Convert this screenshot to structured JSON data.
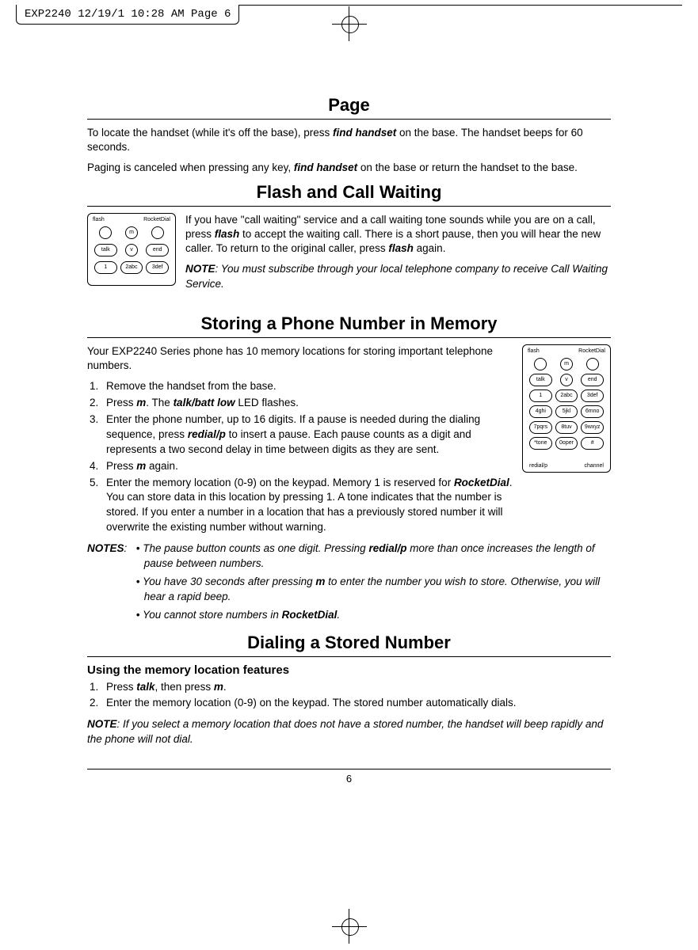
{
  "crop_header": "EXP2240  12/19/1 10:28 AM  Page 6",
  "page_number": "6",
  "section_page": {
    "title": "Page",
    "p1_a": "To locate the handset (while it's off the base), press ",
    "p1_b": "find handset",
    "p1_c": " on the base. The handset beeps for 60 seconds.",
    "p2_a": "Paging is canceled when pressing any key, ",
    "p2_b": "find handset",
    "p2_c": " on the base or return the handset to the base."
  },
  "section_flash": {
    "title": "Flash and Call Waiting",
    "p1_a": "If you have \"call waiting\" service and a call waiting tone sounds while you are on a call, press ",
    "p1_b": "flash",
    "p1_c": " to accept the waiting call. There is a short pause, then you will hear the new caller. To return to the original caller, press ",
    "p1_d": "flash",
    "p1_e": " again.",
    "note_label": "NOTE",
    "note_text": ": You must subscribe through your local telephone company to receive Call Waiting Service.",
    "thumb": {
      "tl": "flash",
      "tr": "RocketDial"
    }
  },
  "section_storing": {
    "title": "Storing a Phone Number in Memory",
    "intro": "Your EXP2240 Series phone has 10 memory locations for storing important telephone numbers.",
    "steps": [
      "Remove the handset from the base.",
      "Press |m|. The |talk/batt low| LED flashes.",
      "Enter the phone number, up to 16 digits. If a pause is needed during the dialing sequence, press |redial/p| to insert a pause. Each pause counts as a digit and represents a two second delay in time between digits as they are sent.",
      "Press |m| again.",
      "Enter the memory location (0-9) on the keypad. Memory 1 is reserved for |RocketDial|. You can store data in this location by pressing 1. A tone indicates that the number is stored. If you enter a number in a location that has a previously stored number it will overwrite the existing number without warning."
    ],
    "notes_label": "NOTES",
    "notes": [
      "The pause button counts as one digit. Pressing |redial/p| more than once increases the length of pause between numbers.",
      "You have 30 seconds after pressing |m| to enter the number you wish to store. Otherwise, you will hear a rapid beep.",
      "You cannot store numbers in |RocketDial|."
    ],
    "thumb": {
      "tl": "flash",
      "tr": "RocketDial",
      "bl": "redial/p",
      "br": "channel"
    }
  },
  "section_dialing": {
    "title": "Dialing a Stored Number",
    "subhead": "Using the memory location features",
    "steps": [
      "Press |talk|, then press |m|.",
      "Enter the memory location (0-9) on the keypad. The stored number automatically dials."
    ],
    "note_label": "NOTE",
    "note_text": ": If you select a memory location that does not have a stored number, the handset will beep rapidly and the phone will not dial."
  }
}
